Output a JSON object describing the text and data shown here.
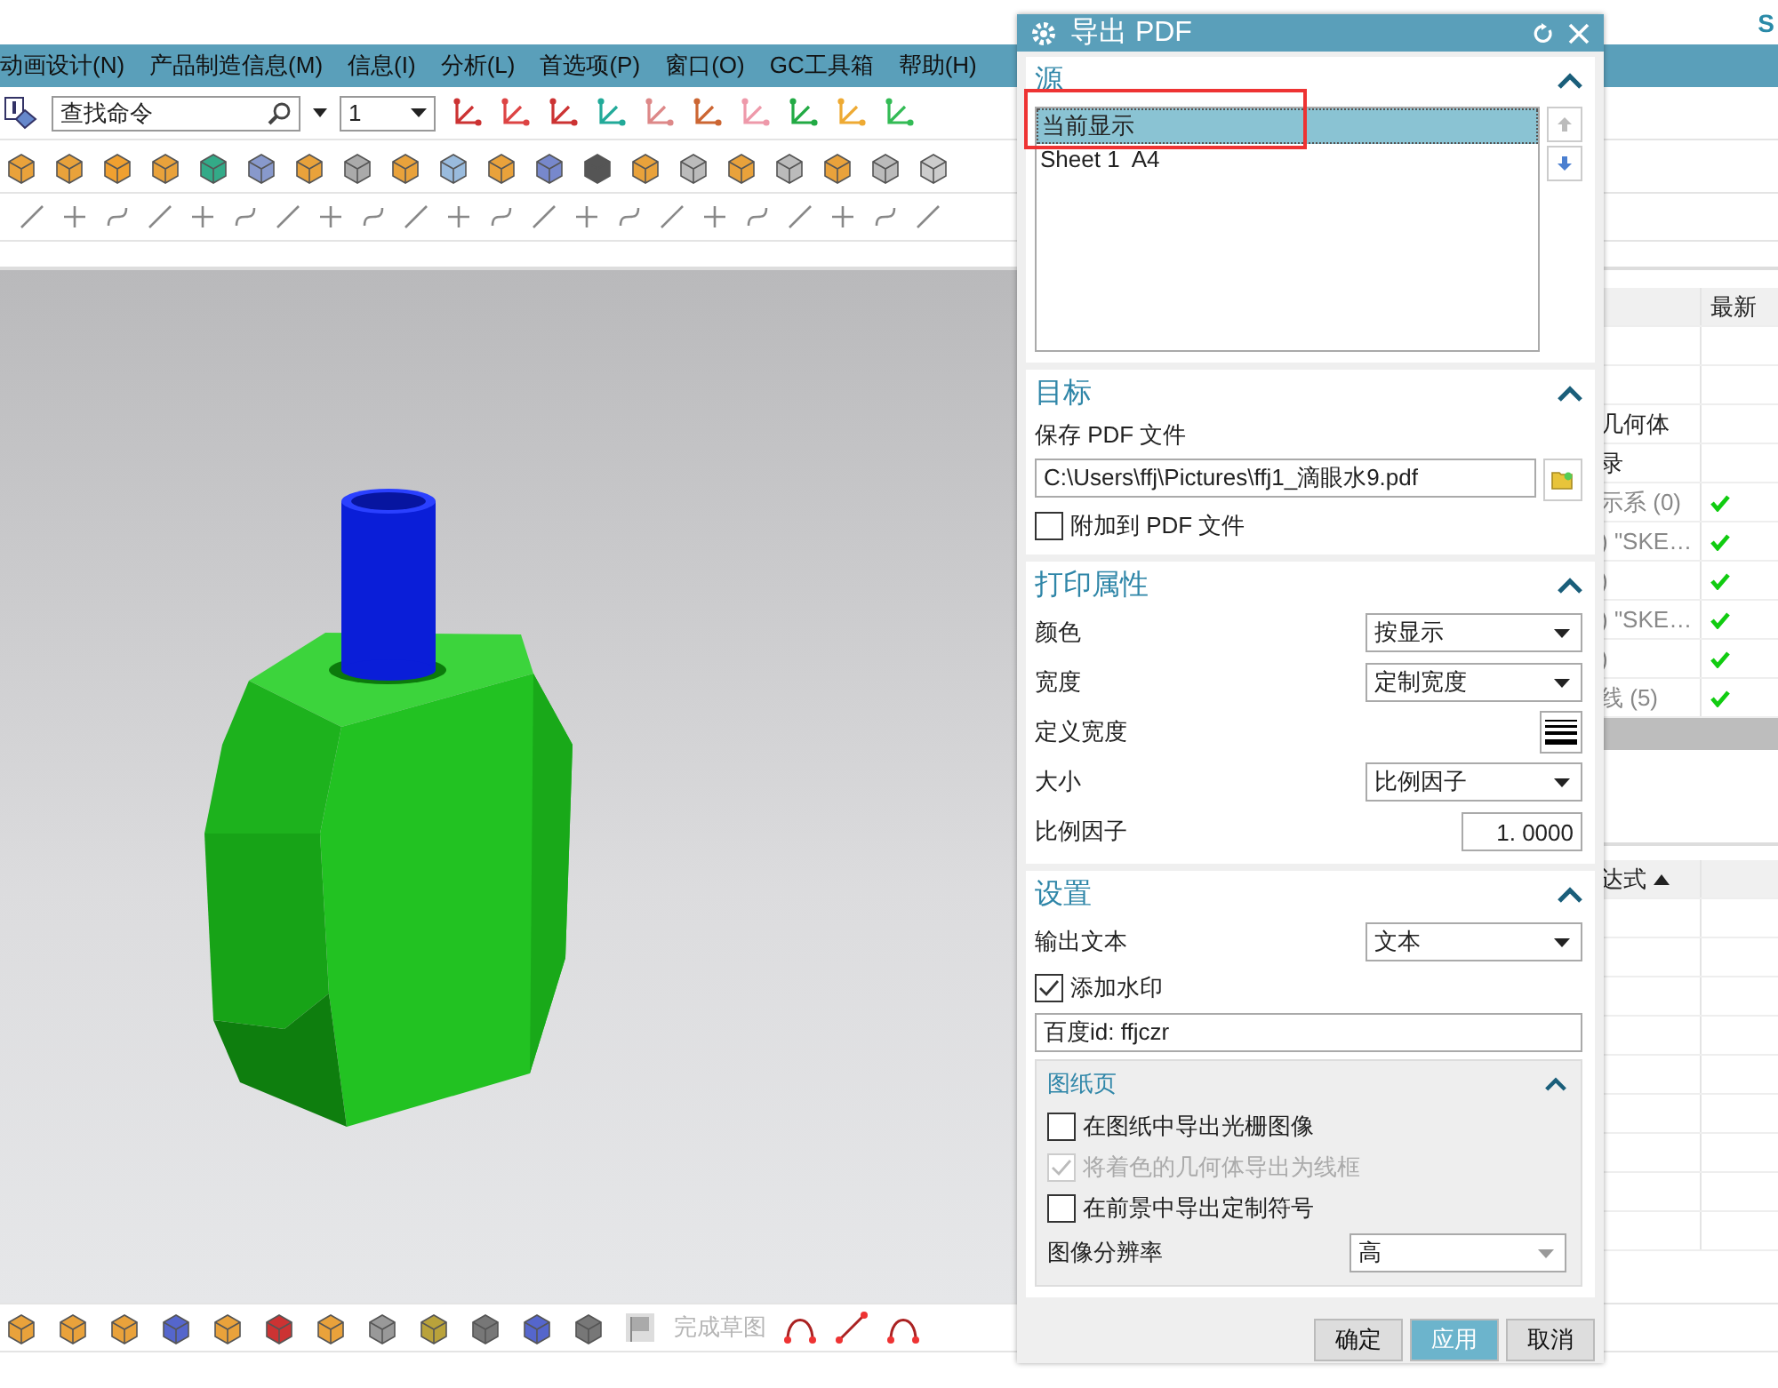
{
  "top_right_text": "S",
  "menu": [
    "动画设计(N)",
    "产品制造信息(M)",
    "信息(I)",
    "分析(L)",
    "首选项(P)",
    "窗口(O)",
    "GC工具箱",
    "帮助(H)"
  ],
  "toolbar": {
    "search": {
      "value": "查找命令"
    },
    "layer_dropdown": "1"
  },
  "part_navigator": {
    "column": "最新",
    "rows": [
      {
        "name": "",
        "latest": false
      },
      {
        "name": "",
        "latest": false
      },
      {
        "name": "几何体",
        "latest": false
      },
      {
        "name": "录",
        "latest": false
      },
      {
        "name": "示系 (0)",
        "latest": true
      },
      {
        "name": ") \"SKE…",
        "latest": true
      },
      {
        "name": ")",
        "latest": true
      },
      {
        "name": ") \"SKE…",
        "latest": true
      },
      {
        "name": ")",
        "latest": true
      },
      {
        "name": "线 (5)",
        "latest": true
      }
    ]
  },
  "expressions": {
    "column": "达式"
  },
  "bottom_toolbar": {
    "finish_sketch": "完成草图"
  },
  "dialog": {
    "title": "导出 PDF",
    "source": {
      "title": "源",
      "expanded": true,
      "items": [
        {
          "label": "当前显示",
          "selected": true
        },
        {
          "label": "Sheet 1  A4",
          "selected": false
        }
      ]
    },
    "target": {
      "title": "目标",
      "expanded": true,
      "file_label": "保存 PDF 文件",
      "file_path": "C:\\Users\\ffj\\Pictures\\ffj1_滴眼水9.pdf",
      "append": {
        "label": "附加到 PDF 文件",
        "checked": false
      }
    },
    "print": {
      "title": "打印属性",
      "expanded": true,
      "rows": [
        {
          "kind": "dropdown",
          "label": "颜色",
          "value": "按显示"
        },
        {
          "kind": "dropdown",
          "label": "宽度",
          "value": "定制宽度"
        },
        {
          "kind": "width-button",
          "label": "定义宽度"
        },
        {
          "kind": "dropdown",
          "label": "大小",
          "value": "比例因子"
        },
        {
          "kind": "number",
          "label": "比例因子",
          "value": "1. 0000"
        }
      ]
    },
    "settings": {
      "title": "设置",
      "expanded": true,
      "output_label": "输出文本",
      "output_value": "文本",
      "watermark": {
        "label": "添加水印",
        "checked": true
      },
      "watermark_text": "百度id: ffjczr",
      "sheets": {
        "title": "图纸页",
        "expanded": true,
        "options": [
          {
            "label": "在图纸中导出光栅图像",
            "checked": false,
            "disabled": false
          },
          {
            "label": "将着色的几何体导出为线框",
            "checked": true,
            "disabled": true
          },
          {
            "label": "在前景中导出定制符号",
            "checked": false,
            "disabled": false
          }
        ],
        "resolution_label": "图像分辨率",
        "resolution_value": "高"
      }
    },
    "buttons": [
      {
        "label": "确定",
        "primary": false
      },
      {
        "label": "应用",
        "primary": true
      },
      {
        "label": "取消",
        "primary": false
      }
    ]
  }
}
